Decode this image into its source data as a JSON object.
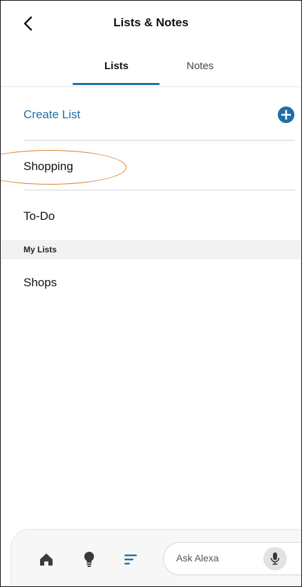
{
  "header": {
    "title": "Lists & Notes",
    "back_icon": "chevron-left-icon"
  },
  "tabs": [
    {
      "label": "Lists",
      "selected": true
    },
    {
      "label": "Notes",
      "selected": false
    }
  ],
  "create": {
    "label": "Create List",
    "icon": "plus-circle-icon"
  },
  "lists": [
    {
      "label": "Shopping"
    },
    {
      "label": "To-Do"
    }
  ],
  "my_lists": {
    "header": "My Lists",
    "items": [
      {
        "label": "Shops"
      }
    ]
  },
  "bottom_nav": {
    "items": [
      {
        "icon": "home-icon"
      },
      {
        "icon": "lightbulb-icon"
      },
      {
        "icon": "lists-icon",
        "active": true
      }
    ],
    "ask_placeholder": "Ask Alexa",
    "mic_icon": "microphone-icon"
  },
  "colors": {
    "accent": "#1e6fa8",
    "annotation": "#d9822b"
  }
}
